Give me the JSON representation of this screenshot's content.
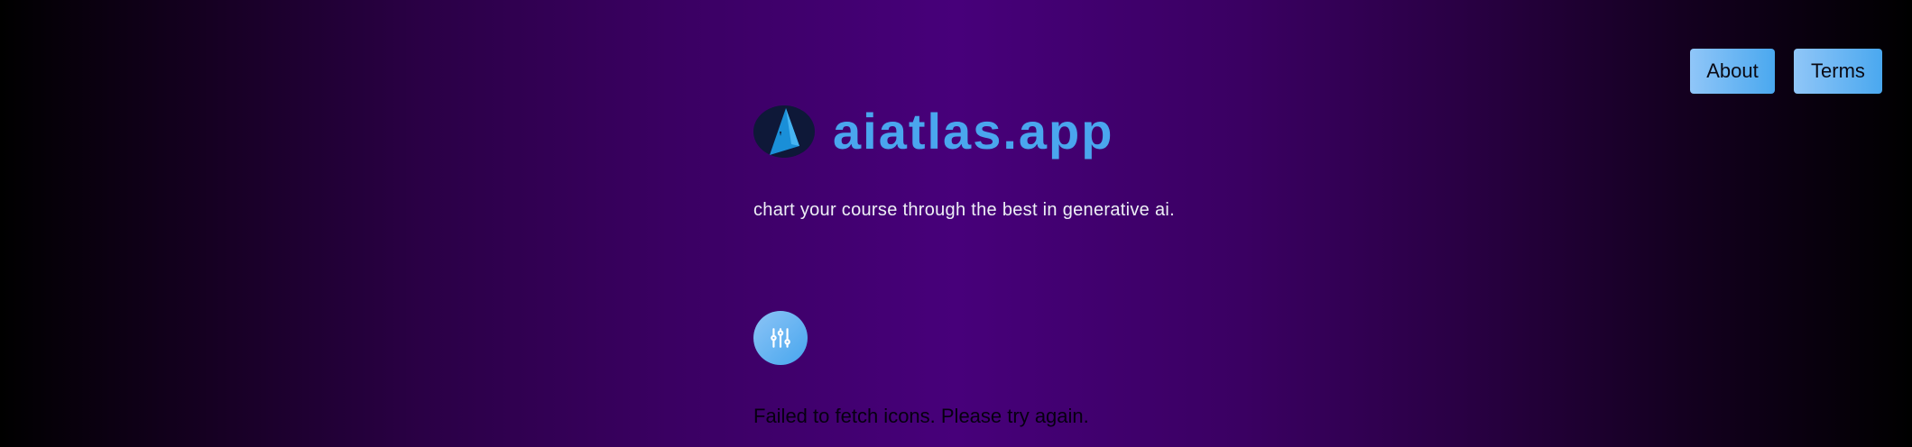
{
  "nav": {
    "about_label": "About",
    "terms_label": "Terms"
  },
  "brand": {
    "logo_icon": "atlas-sail-logo-icon",
    "title": "aiatlas.app",
    "tagline": "chart your course through the best in generative ai."
  },
  "filters": {
    "icon": "sliders-icon"
  },
  "status": {
    "error_message": "Failed to fetch icons. Please try again."
  },
  "colors": {
    "accent": "#4aa6ee",
    "button_gradient_start": "#90c6f8",
    "button_gradient_end": "#4aa8ef",
    "background_center": "#47007a",
    "background_edge": "#000000",
    "logo_circle": "#0e1838"
  }
}
